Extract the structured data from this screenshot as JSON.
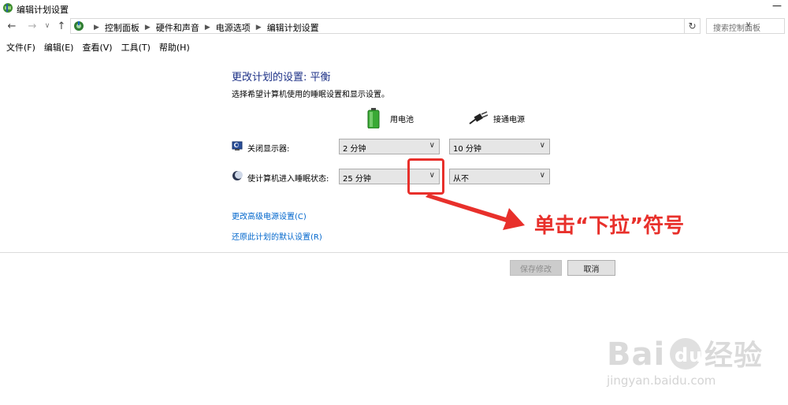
{
  "window": {
    "title": "编辑计划设置",
    "minimize_glyph": "—"
  },
  "nav": {
    "back": "←",
    "forward": "→",
    "recent": "∨",
    "up": "↑"
  },
  "address": {
    "crumbs": [
      "控制面板",
      "硬件和声音",
      "电源选项",
      "编辑计划设置"
    ],
    "dropdown_glyph": "∨",
    "refresh_glyph": "↻"
  },
  "search": {
    "placeholder": "搜索控制面板"
  },
  "menu": [
    "文件(F)",
    "编辑(E)",
    "查看(V)",
    "工具(T)",
    "帮助(H)"
  ],
  "main": {
    "heading": "更改计划的设置: 平衡",
    "subheading": "选择希望计算机使用的睡眠设置和显示设置。",
    "col_battery": "用电池",
    "col_plugged": "接通电源",
    "rows": [
      {
        "label": "关闭显示器:",
        "battery": "2 分钟",
        "plugged": "10 分钟",
        "icon": "monitor-icon"
      },
      {
        "label": "使计算机进入睡眠状态:",
        "battery": "25 分钟",
        "plugged": "从不",
        "icon": "moon-icon"
      }
    ],
    "links": [
      "更改高级电源设置(C)",
      "还原此计划的默认设置(R)"
    ]
  },
  "buttons": {
    "save": "保存修改",
    "cancel": "取消"
  },
  "annotation": {
    "text": "单击“下拉”符号",
    "color": "#e8302b"
  },
  "watermark": {
    "logo_text": "Bai du 经验",
    "url": "jingyan.baidu.com"
  },
  "colors": {
    "heading": "#1e3287",
    "link": "#0066cc",
    "annotation": "#e8302b"
  }
}
